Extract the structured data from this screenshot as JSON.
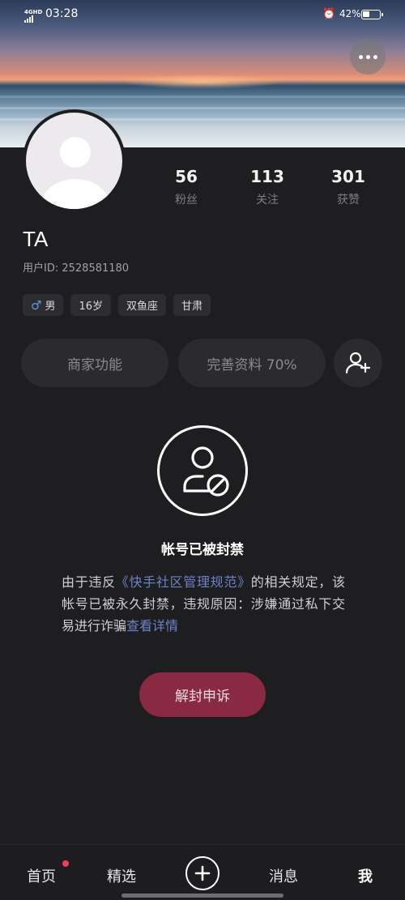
{
  "status": {
    "network": "4GHD",
    "time": "03:28",
    "battery": "42%",
    "battery_level": 0.42
  },
  "profile": {
    "name": "TA",
    "user_id": "用户ID: 2528581180",
    "stats": [
      {
        "value": "56",
        "label": "粉丝"
      },
      {
        "value": "113",
        "label": "关注"
      },
      {
        "value": "301",
        "label": "获赞"
      }
    ],
    "tags": {
      "gender": "男",
      "age": "16岁",
      "zodiac": "双鱼座",
      "region": "甘肃"
    }
  },
  "actions": {
    "merchant": "商家功能",
    "complete_profile": "完善资料 70%"
  },
  "ban": {
    "title": "帐号已被封禁",
    "text_1": "由于违反",
    "link_rules": "《快手社区管理规范》",
    "text_2": "的相关规定，该帐号已被永久封禁，违规原因：涉嫌通过私下交易进行诈骗",
    "link_details": "查看详情",
    "appeal": "解封申诉"
  },
  "tabbar": {
    "home": "首页",
    "featured": "精选",
    "messages": "消息",
    "me": "我"
  }
}
